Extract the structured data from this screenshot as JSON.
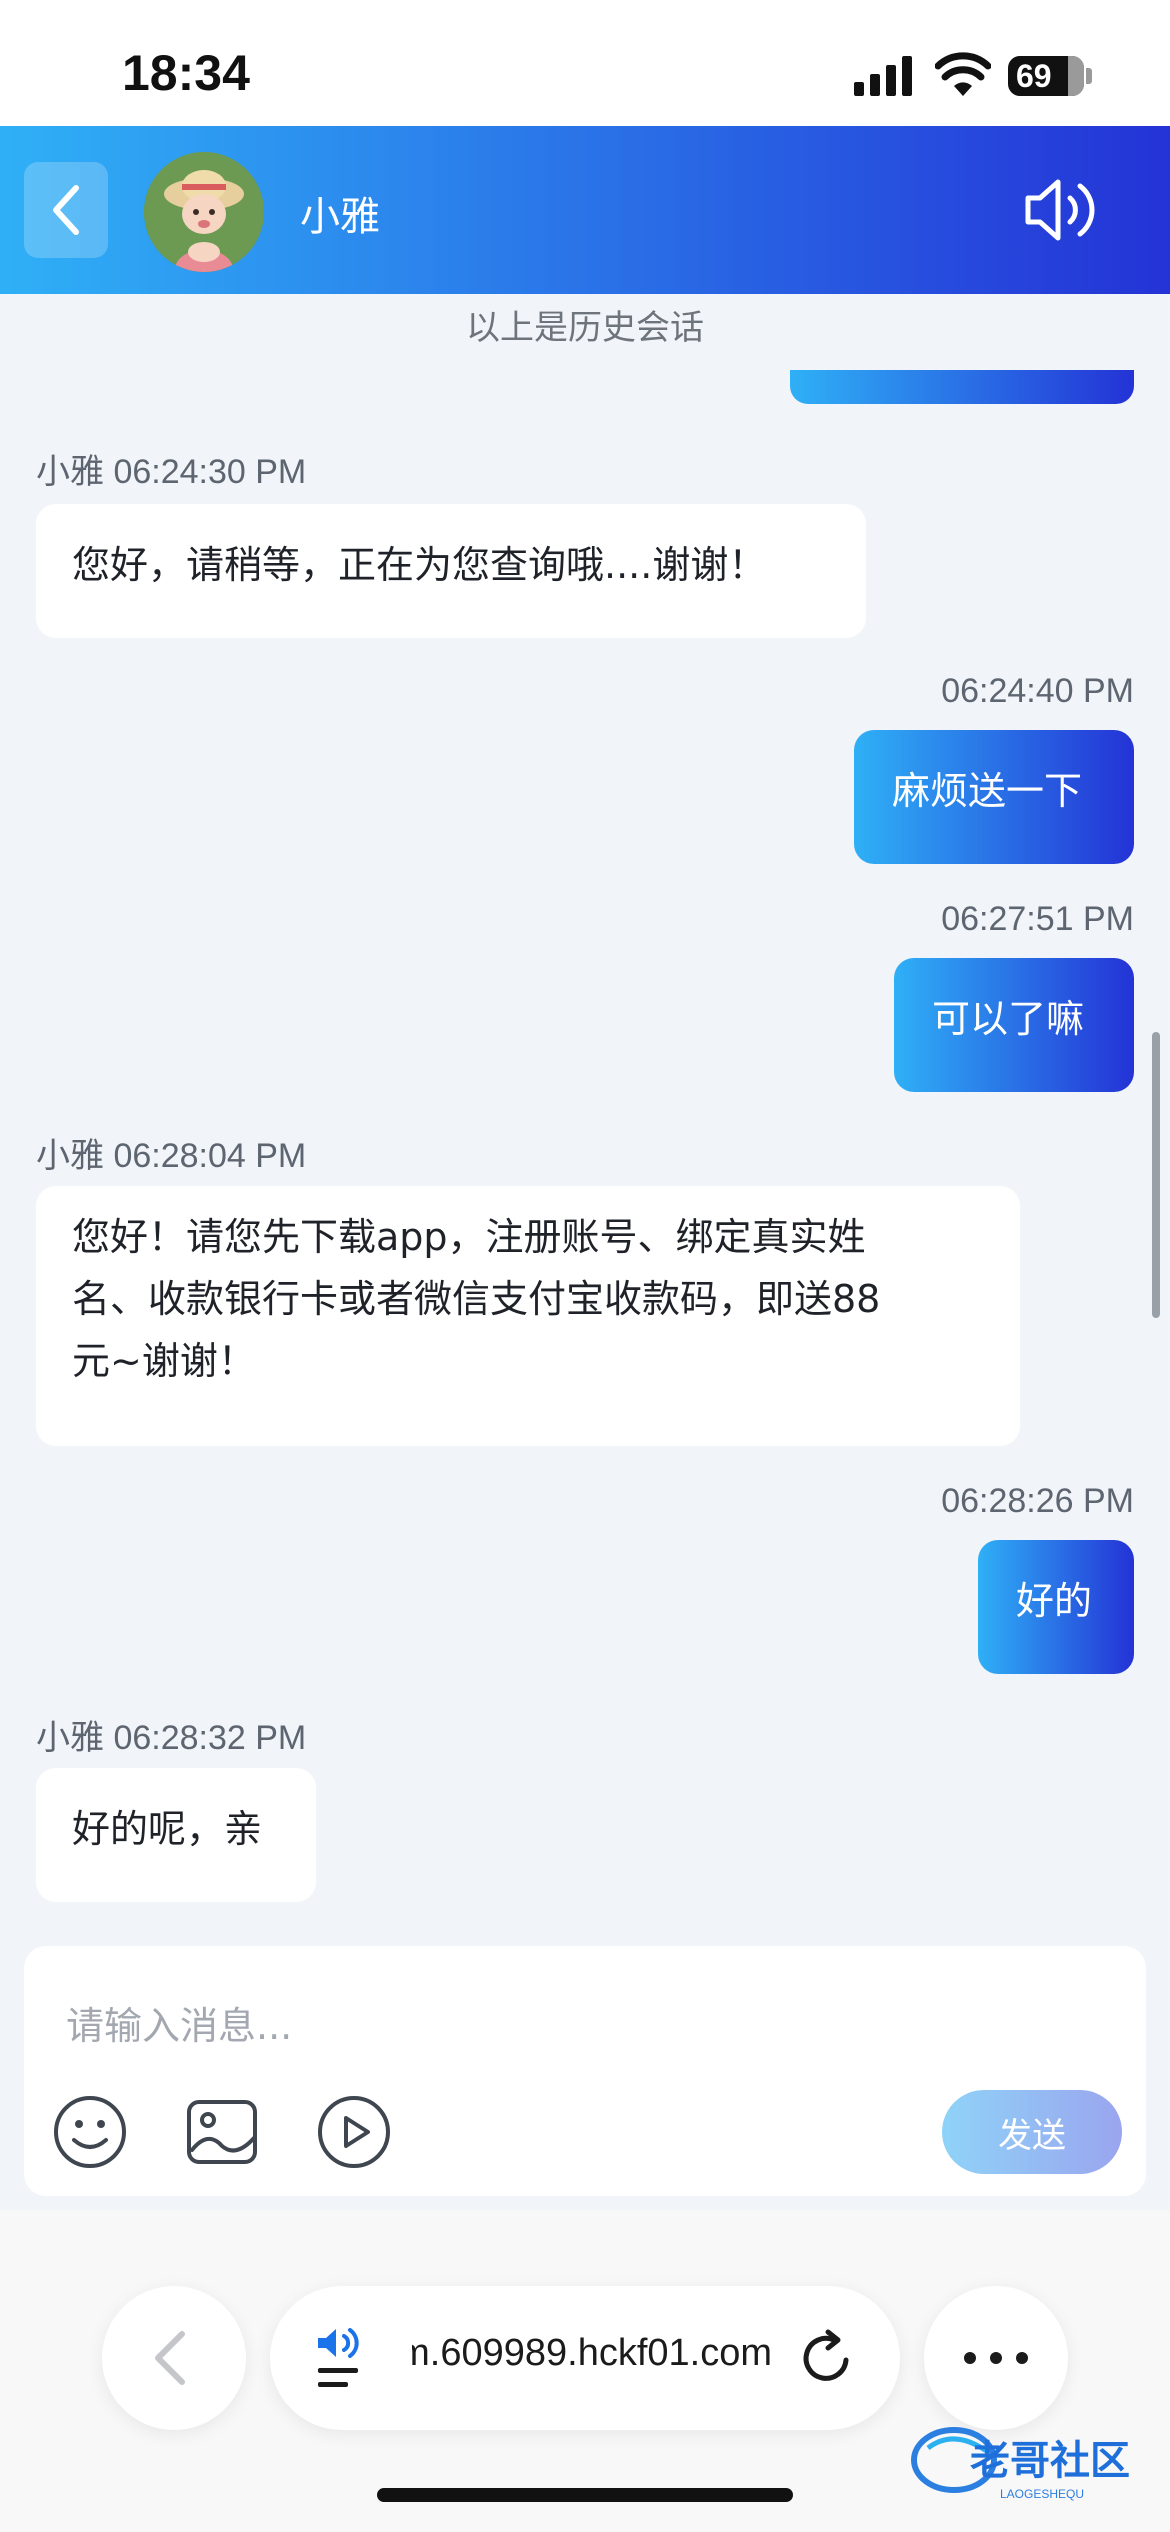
{
  "status_bar": {
    "time": "18:34",
    "battery": "69"
  },
  "header": {
    "contact_name": "小雅"
  },
  "chat": {
    "history_note": "以上是历史会话",
    "messages": [
      {
        "side": "in",
        "sender": "小雅",
        "time": "06:24:30 PM",
        "text": "您好，请稍等，正在为您查询哦....谢谢！"
      },
      {
        "side": "out",
        "time": "06:24:40 PM",
        "text": "麻烦送一下"
      },
      {
        "side": "out",
        "time": "06:27:51 PM",
        "text": "可以了嘛"
      },
      {
        "side": "in",
        "sender": "小雅",
        "time": "06:28:04 PM",
        "lines": [
          "您好！请您先下载app，注册账号、绑定真实姓",
          "名、收款银行卡或者微信支付宝收款码，即送88",
          "元~谢谢！"
        ]
      },
      {
        "side": "out",
        "time": "06:28:26 PM",
        "text": "好的"
      },
      {
        "side": "in",
        "sender": "小雅",
        "time": "06:28:32 PM",
        "text": "好的呢，亲"
      }
    ]
  },
  "composer": {
    "placeholder": "请输入消息...",
    "send_label": "发送"
  },
  "browser": {
    "url": "https://m.609989.hckf01.com"
  },
  "watermark": {
    "main": "老哥社区",
    "sub": "LAOGESHEQU"
  },
  "colors": {
    "gradient_start": "#2fb0f6",
    "gradient_end": "#2433d6",
    "background": "#f1f4f8"
  }
}
